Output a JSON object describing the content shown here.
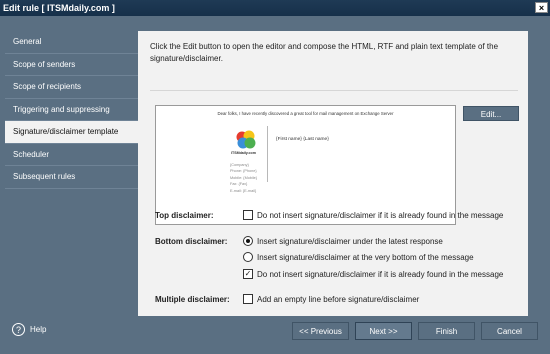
{
  "window": {
    "title": "Edit rule [ ITSMdaily.com ]",
    "close_glyph": "×"
  },
  "sidebar": {
    "items": [
      {
        "label": "General"
      },
      {
        "label": "Scope of senders"
      },
      {
        "label": "Scope of recipients"
      },
      {
        "label": "Triggering and suppressing"
      },
      {
        "label": "Signature/disclaimer template",
        "active": true
      },
      {
        "label": "Scheduler"
      },
      {
        "label": "Subsequent rules"
      }
    ],
    "help_label": "Help",
    "help_glyph": "?"
  },
  "main": {
    "intro_text": "Click the Edit button to open the editor and compose the HTML, RTF and plain text template of the signature/disclaimer.",
    "edit_button": "Edit...",
    "preview": {
      "intro": "Dear folks, I have recently discovered a great tool for mail management on Exchange Server",
      "brand": "ITSMdaily.com",
      "name_line": "{First name} {Last name}",
      "contact_lines": [
        "{Company}",
        "Phone: {Phone}",
        "Mobile: {Mobile}",
        "Fax: {Fax}",
        "E-mail: {E-mail}"
      ]
    },
    "top_disclaimer": {
      "label": "Top disclaimer:",
      "option": "Do not insert signature/disclaimer if it is already found in the message",
      "checked": false
    },
    "bottom_disclaimer": {
      "label": "Bottom disclaimer:",
      "option_latest": "Insert signature/disclaimer under the latest response",
      "option_bottom": "Insert signature/disclaimer at the very bottom of the message",
      "option_skip": "Do not insert signature/disclaimer if it is already found in the message",
      "selected": "latest",
      "skip_checked": true,
      "check_glyph": "✓"
    },
    "multiple_disclaimer": {
      "label": "Multiple disclaimer:",
      "option": "Add an empty line before signature/disclaimer",
      "checked": false
    }
  },
  "footer": {
    "previous": "<< Previous",
    "next": "Next >>",
    "finish": "Finish",
    "cancel": "Cancel"
  },
  "colors": {
    "sidebar_bg": "#5a6f82",
    "panel_bg": "#f2f2f2",
    "titlebar_bg": "#1f3a55",
    "active_item_bg": "#f2f2f2"
  }
}
